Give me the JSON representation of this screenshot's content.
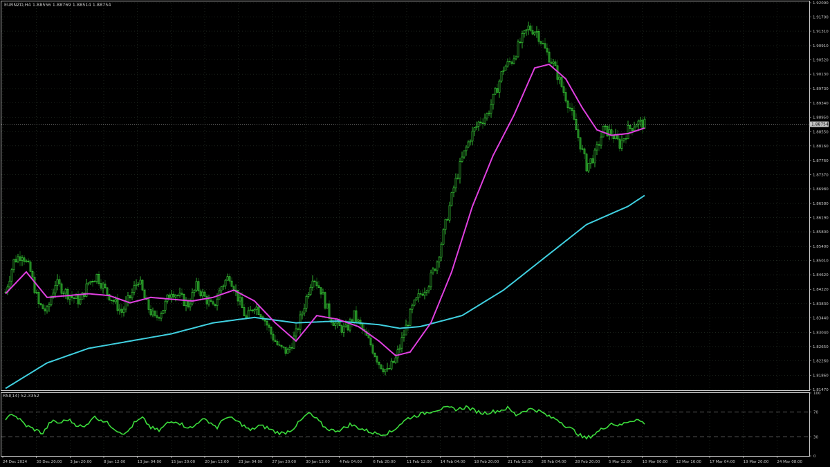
{
  "window": {
    "symbol_header": "EURNZD,H4  1.88556 1.88769 1.88514 1.88754",
    "rsi_header": "RSI(14) 52.3352",
    "current_price_label": "1.88754"
  },
  "colors": {
    "background": "#000000",
    "grid": "#2e3a2e",
    "frame": "#c8c8c8",
    "bull_candle": "#3cdc3c",
    "bear_candle": "#1a6e1a",
    "ma_fast": "#e040e0",
    "ma_slow": "#40d0e0",
    "rsi_line": "#3cdc3c",
    "text": "#c8c8c8"
  },
  "chart_data": [
    {
      "type": "candlestick",
      "title": "EURNZD,H4",
      "ylim": [
        1.8147,
        1.9209
      ],
      "y_ticks": [
        "1.92090",
        "1.91700",
        "1.91310",
        "1.90910",
        "1.90520",
        "1.90130",
        "1.89730",
        "1.89340",
        "1.88950",
        "1.88550",
        "1.88160",
        "1.87760",
        "1.87370",
        "1.86980",
        "1.86580",
        "1.86190",
        "1.85800",
        "1.85400",
        "1.85010",
        "1.84620",
        "1.84220",
        "1.83830",
        "1.83440",
        "1.83040",
        "1.82650",
        "1.82260",
        "1.81860",
        "1.81470"
      ],
      "x_ticks": [
        "24 Dec 2024",
        "30 Dec 20:00",
        "3 Jan 20:00",
        "8 Jan 12:00",
        "13 Jan 04:00",
        "15 Jan 20:00",
        "20 Jan 12:00",
        "23 Jan 04:00",
        "27 Jan 20:00",
        "30 Jan 12:00",
        "4 Feb 04:00",
        "6 Feb 20:00",
        "11 Feb 12:00",
        "14 Feb 04:00",
        "18 Feb 20:00",
        "21 Feb 12:00",
        "26 Feb 04:00",
        "28 Feb 20:00",
        "5 Mar 12:00",
        "10 Mar 00:00",
        "12 Mar 16:00",
        "17 Mar 04:00",
        "19 Mar 20:00",
        "24 Mar 08:00"
      ],
      "close_anchors": [
        [
          0,
          1.8415
        ],
        [
          4,
          1.85
        ],
        [
          8,
          1.852
        ],
        [
          12,
          1.847
        ],
        [
          16,
          1.838
        ],
        [
          20,
          1.836
        ],
        [
          24,
          1.844
        ],
        [
          28,
          1.842
        ],
        [
          32,
          1.84
        ],
        [
          36,
          1.839
        ],
        [
          40,
          1.844
        ],
        [
          44,
          1.846
        ],
        [
          48,
          1.842
        ],
        [
          52,
          1.839
        ],
        [
          56,
          1.836
        ],
        [
          60,
          1.84
        ],
        [
          64,
          1.845
        ],
        [
          68,
          1.838
        ],
        [
          72,
          1.834
        ],
        [
          76,
          1.837
        ],
        [
          80,
          1.842
        ],
        [
          84,
          1.84
        ],
        [
          88,
          1.838
        ],
        [
          92,
          1.843
        ],
        [
          96,
          1.84
        ],
        [
          100,
          1.837
        ],
        [
          104,
          1.843
        ],
        [
          108,
          1.846
        ],
        [
          112,
          1.84
        ],
        [
          116,
          1.834
        ],
        [
          120,
          1.838
        ],
        [
          124,
          1.835
        ],
        [
          128,
          1.83
        ],
        [
          132,
          1.826
        ],
        [
          136,
          1.825
        ],
        [
          140,
          1.83
        ],
        [
          144,
          1.838
        ],
        [
          148,
          1.846
        ],
        [
          152,
          1.842
        ],
        [
          156,
          1.835
        ],
        [
          160,
          1.832
        ],
        [
          164,
          1.831
        ],
        [
          168,
          1.835
        ],
        [
          172,
          1.831
        ],
        [
          176,
          1.827
        ],
        [
          180,
          1.822
        ],
        [
          184,
          1.8195
        ],
        [
          188,
          1.823
        ],
        [
          192,
          1.83
        ],
        [
          196,
          1.837
        ],
        [
          200,
          1.841
        ],
        [
          204,
          1.844
        ],
        [
          208,
          1.85
        ],
        [
          212,
          1.86
        ],
        [
          216,
          1.87
        ],
        [
          220,
          1.878
        ],
        [
          224,
          1.884
        ],
        [
          228,
          1.888
        ],
        [
          232,
          1.89
        ],
        [
          236,
          1.896
        ],
        [
          240,
          1.903
        ],
        [
          244,
          1.905
        ],
        [
          248,
          1.91
        ],
        [
          252,
          1.914
        ],
        [
          256,
          1.913
        ],
        [
          260,
          1.908
        ],
        [
          264,
          1.904
        ],
        [
          268,
          1.898
        ],
        [
          272,
          1.892
        ],
        [
          276,
          1.884
        ],
        [
          280,
          1.876
        ],
        [
          284,
          1.879
        ],
        [
          288,
          1.886
        ],
        [
          292,
          1.885
        ],
        [
          296,
          1.882
        ],
        [
          300,
          1.886
        ],
        [
          304,
          1.888
        ],
        [
          308,
          1.8875
        ]
      ],
      "series": [
        {
          "name": "MA fast",
          "values": [
            [
              0,
              1.841
            ],
            [
              10,
              1.847
            ],
            [
              20,
              1.84
            ],
            [
              30,
              1.8405
            ],
            [
              40,
              1.841
            ],
            [
              50,
              1.8405
            ],
            [
              60,
              1.8385
            ],
            [
              70,
              1.84
            ],
            [
              80,
              1.8395
            ],
            [
              90,
              1.839
            ],
            [
              100,
              1.84
            ],
            [
              110,
              1.842
            ],
            [
              120,
              1.839
            ],
            [
              130,
              1.833
            ],
            [
              140,
              1.828
            ],
            [
              150,
              1.835
            ],
            [
              160,
              1.834
            ],
            [
              170,
              1.832
            ],
            [
              180,
              1.828
            ],
            [
              188,
              1.824
            ],
            [
              195,
              1.825
            ],
            [
              205,
              1.833
            ],
            [
              215,
              1.847
            ],
            [
              225,
              1.865
            ],
            [
              235,
              1.879
            ],
            [
              245,
              1.89
            ],
            [
              255,
              1.903
            ],
            [
              262,
              1.904
            ],
            [
              270,
              1.9
            ],
            [
              278,
              1.892
            ],
            [
              285,
              1.886
            ],
            [
              292,
              1.8845
            ],
            [
              300,
              1.885
            ],
            [
              308,
              1.8865
            ]
          ]
        },
        {
          "name": "MA slow",
          "values": [
            [
              0,
              1.815
            ],
            [
              20,
              1.822
            ],
            [
              40,
              1.826
            ],
            [
              60,
              1.828
            ],
            [
              80,
              1.83
            ],
            [
              100,
              1.833
            ],
            [
              120,
              1.8345
            ],
            [
              140,
              1.833
            ],
            [
              160,
              1.8335
            ],
            [
              180,
              1.8325
            ],
            [
              190,
              1.8315
            ],
            [
              200,
              1.832
            ],
            [
              220,
              1.835
            ],
            [
              240,
              1.842
            ],
            [
              260,
              1.851
            ],
            [
              280,
              1.86
            ],
            [
              300,
              1.865
            ],
            [
              308,
              1.868
            ]
          ]
        }
      ]
    },
    {
      "type": "line",
      "title": "RSI(14) 52.3352",
      "ylim": [
        0,
        100
      ],
      "y_ticks": [
        "100",
        "70",
        "30",
        "0"
      ],
      "levels": [
        70,
        30
      ],
      "series": [
        {
          "name": "RSI(14)",
          "values": [
            [
              0,
              55
            ],
            [
              3,
              68
            ],
            [
              6,
              60
            ],
            [
              10,
              48
            ],
            [
              14,
              42
            ],
            [
              18,
              36
            ],
            [
              22,
              55
            ],
            [
              26,
              52
            ],
            [
              30,
              58
            ],
            [
              34,
              50
            ],
            [
              38,
              45
            ],
            [
              42,
              62
            ],
            [
              46,
              58
            ],
            [
              50,
              50
            ],
            [
              54,
              40
            ],
            [
              58,
              35
            ],
            [
              62,
              52
            ],
            [
              66,
              60
            ],
            [
              70,
              45
            ],
            [
              74,
              40
            ],
            [
              78,
              52
            ],
            [
              82,
              56
            ],
            [
              86,
              48
            ],
            [
              90,
              44
            ],
            [
              94,
              58
            ],
            [
              98,
              55
            ],
            [
              102,
              45
            ],
            [
              106,
              62
            ],
            [
              110,
              58
            ],
            [
              114,
              50
            ],
            [
              118,
              40
            ],
            [
              122,
              48
            ],
            [
              126,
              45
            ],
            [
              130,
              38
            ],
            [
              134,
              36
            ],
            [
              138,
              42
            ],
            [
              142,
              55
            ],
            [
              146,
              68
            ],
            [
              150,
              58
            ],
            [
              154,
              45
            ],
            [
              158,
              40
            ],
            [
              162,
              42
            ],
            [
              166,
              50
            ],
            [
              170,
              45
            ],
            [
              174,
              40
            ],
            [
              178,
              36
            ],
            [
              182,
              35
            ],
            [
              186,
              38
            ],
            [
              190,
              50
            ],
            [
              194,
              60
            ],
            [
              198,
              64
            ],
            [
              202,
              68
            ],
            [
              206,
              72
            ],
            [
              210,
              75
            ],
            [
              214,
              76
            ],
            [
              218,
              74
            ],
            [
              222,
              78
            ],
            [
              226,
              72
            ],
            [
              230,
              68
            ],
            [
              234,
              70
            ],
            [
              238,
              72
            ],
            [
              242,
              76
            ],
            [
              246,
              65
            ],
            [
              250,
              72
            ],
            [
              254,
              75
            ],
            [
              258,
              70
            ],
            [
              262,
              62
            ],
            [
              266,
              58
            ],
            [
              270,
              48
            ],
            [
              274,
              40
            ],
            [
              278,
              30
            ],
            [
              280,
              28
            ],
            [
              284,
              35
            ],
            [
              288,
              44
            ],
            [
              292,
              52
            ],
            [
              296,
              48
            ],
            [
              300,
              55
            ],
            [
              304,
              58
            ],
            [
              308,
              52
            ]
          ]
        }
      ]
    }
  ]
}
